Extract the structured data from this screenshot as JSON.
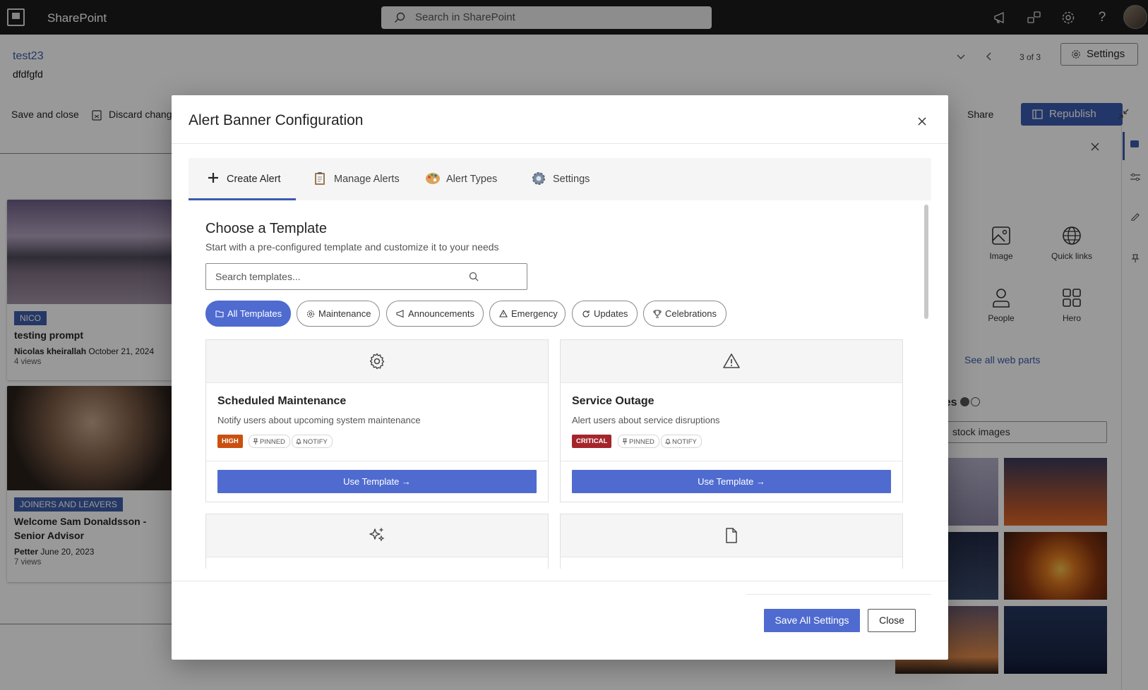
{
  "suite": {
    "brand": "SharePoint",
    "search_placeholder": "Search in SharePoint"
  },
  "page": {
    "title": "test23",
    "subtitle": "dfdfgfd",
    "pager": "3 of 3",
    "settings_label": "Settings",
    "commands": {
      "save_close": "Save and close",
      "discard": "Discard change",
      "share": "Share",
      "republish": "Republish"
    }
  },
  "news": [
    {
      "tag": "NICO",
      "title": "testing prompt",
      "author": "Nicolas kheirallah",
      "date": "October 21, 2024",
      "views": "4 views"
    },
    {
      "tag": "JOINERS AND LEAVERS",
      "title": "Welcome Sam Donaldsson - Senior Advisor",
      "author": "Petter",
      "date": "June 20, 2023",
      "views": "7 views"
    }
  ],
  "toolbox": {
    "items": [
      {
        "label": "Image",
        "icon": "image-icon"
      },
      {
        "label": "Quick links",
        "icon": "globe-icon"
      },
      {
        "label": "People",
        "icon": "person-icon"
      },
      {
        "label": "Hero",
        "icon": "hero-grid-icon"
      }
    ],
    "see_all": "See all web parts",
    "images_heading": "ges",
    "stock_search": "stock images"
  },
  "dialog": {
    "title": "Alert Banner Configuration",
    "tabs": [
      {
        "label": "Create Alert",
        "icon": "plus-icon"
      },
      {
        "label": "Manage Alerts",
        "icon": "clipboard-icon"
      },
      {
        "label": "Alert Types",
        "icon": "palette-icon"
      },
      {
        "label": "Settings",
        "icon": "gear-icon"
      }
    ],
    "content": {
      "heading": "Choose a Template",
      "subheading": "Start with a pre-configured template and customize it to your needs",
      "search_placeholder": "Search templates...",
      "filters": [
        "All Templates",
        "Maintenance",
        "Announcements",
        "Emergency",
        "Updates",
        "Celebrations"
      ],
      "templates": [
        {
          "name": "Scheduled Maintenance",
          "description": "Notify users about upcoming system maintenance",
          "priority": "HIGH",
          "priority_color": "#ca5010",
          "tags": [
            "PINNED",
            "NOTIFY"
          ],
          "button": "Use Template →",
          "icon": "gear-icon"
        },
        {
          "name": "Service Outage",
          "description": "Alert users about service disruptions",
          "priority": "CRITICAL",
          "priority_color": "#a4262c",
          "tags": [
            "PINNED",
            "NOTIFY"
          ],
          "button": "Use Template →",
          "icon": "warning-icon"
        }
      ]
    },
    "footer": {
      "save": "Save All Settings",
      "close": "Close"
    }
  }
}
